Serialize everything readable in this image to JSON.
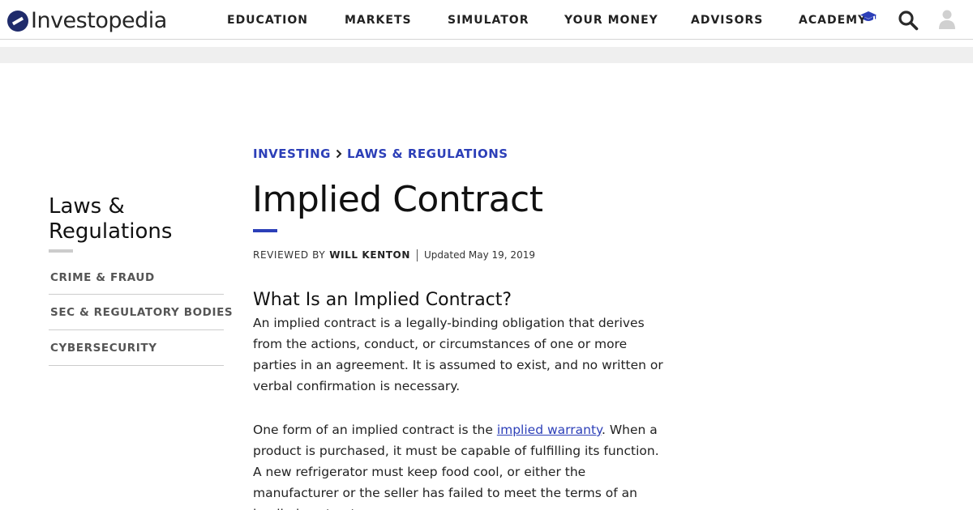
{
  "header": {
    "logo_text": "Investopedia",
    "nav": [
      {
        "label": "EDUCATION"
      },
      {
        "label": "MARKETS"
      },
      {
        "label": "SIMULATOR"
      },
      {
        "label": "YOUR MONEY"
      },
      {
        "label": "ADVISORS"
      },
      {
        "label": "ACADEMY"
      }
    ],
    "icons": [
      "graduation-cap-icon",
      "search-icon",
      "user-icon"
    ]
  },
  "sidebar": {
    "title": "Laws & Regulations",
    "items": [
      {
        "label": "CRIME & FRAUD"
      },
      {
        "label": "SEC & REGULATORY BODIES"
      },
      {
        "label": "CYBERSECURITY"
      }
    ]
  },
  "article": {
    "breadcrumb": [
      {
        "label": "INVESTING"
      },
      {
        "label": "LAWS & REGULATIONS"
      }
    ],
    "title": "Implied Contract",
    "reviewed_by_label": "REVIEWED BY",
    "reviewer": "WILL KENTON",
    "updated": "Updated May 19, 2019",
    "section_heading": "What Is an Implied Contract?",
    "paragraph_1": "An implied contract is a legally-binding obligation that derives from the actions, conduct, or circumstances of one or more parties in an agreement. It is assumed to exist, and no written or verbal confirmation is necessary.",
    "paragraph_2_before": "One form of an implied contract is the ",
    "paragraph_2_link": "implied warranty",
    "paragraph_2_after": ". When a product is purchased, it must be capable of fulfilling its function. A new refrigerator must keep food cool, or either the manufacturer or the seller has failed to meet the terms of an implied contract."
  },
  "colors": {
    "accent": "#2c3fb8",
    "logo_mark": "#1f2b6b",
    "ad_strip": "#efefef"
  }
}
